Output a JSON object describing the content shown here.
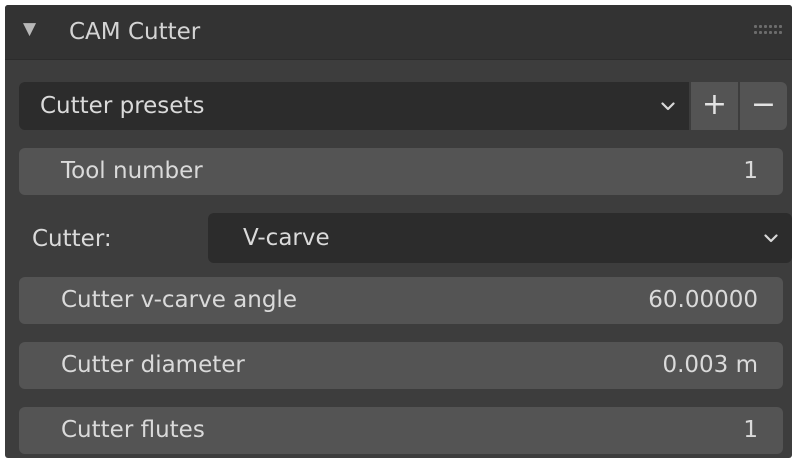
{
  "panel": {
    "title": "CAM Cutter",
    "collapse_icon": "triangle-down-icon",
    "grip_icon": "drag-grip-icon"
  },
  "presets": {
    "label": "Cutter presets",
    "add_label": "+",
    "remove_label": "−"
  },
  "tool_number": {
    "label": "Tool number",
    "value": "1"
  },
  "cutter": {
    "label": "Cutter:",
    "value": "V-carve"
  },
  "vcarve_angle": {
    "label": "Cutter v-carve angle",
    "value": "60.00000"
  },
  "diameter": {
    "label": "Cutter diameter",
    "value": "0.003 m"
  },
  "flutes": {
    "label": "Cutter flutes",
    "value": "1"
  },
  "colors": {
    "panel_bg": "#3d3d3d",
    "header_bg": "#333333",
    "field_bg": "#545454",
    "dropdown_bg": "#2c2c2c",
    "text": "#dadada"
  }
}
